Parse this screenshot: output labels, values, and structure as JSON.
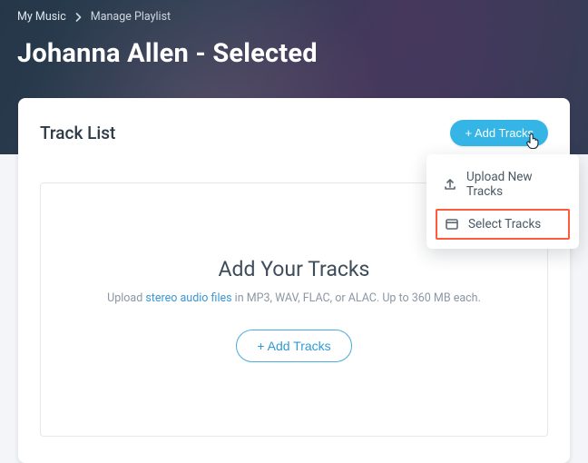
{
  "breadcrumb": {
    "root": "My Music",
    "current": "Manage Playlist"
  },
  "page_title": "Johanna Allen - Selected",
  "card": {
    "title": "Track List",
    "add_button_label": "+ Add Tracks"
  },
  "dropdown": {
    "items": [
      {
        "icon": "upload-icon",
        "label": "Upload New Tracks"
      },
      {
        "icon": "select-icon",
        "label": "Select Tracks"
      }
    ]
  },
  "empty_state": {
    "heading": "Add Your Tracks",
    "sub_prefix": "Upload ",
    "link_text": "stereo audio files",
    "sub_suffix": " in MP3, WAV, FLAC, or ALAC. Up to 360 MB each.",
    "cta_label": "+ Add Tracks"
  }
}
